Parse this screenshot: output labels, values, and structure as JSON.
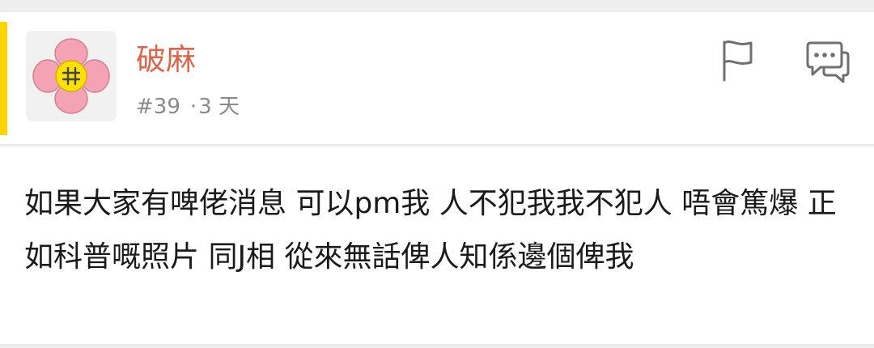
{
  "post": {
    "username": "破麻",
    "floor": "#39",
    "separator": "·",
    "age": "3 天",
    "content": "如果大家有啤佬消息 可以pm我 人不犯我我不犯人 唔會篤爆 正如科普嘅照片 同J相 從來無話俾人知係邊個俾我"
  },
  "icons": {
    "avatar": "flower-avatar-icon",
    "report": "flag-icon",
    "reply": "speech-bubble-icon"
  },
  "colors": {
    "accent": "#ffd400",
    "username": "#d9664a",
    "meta": "#8a8a8a",
    "text": "#1a1a1a"
  }
}
